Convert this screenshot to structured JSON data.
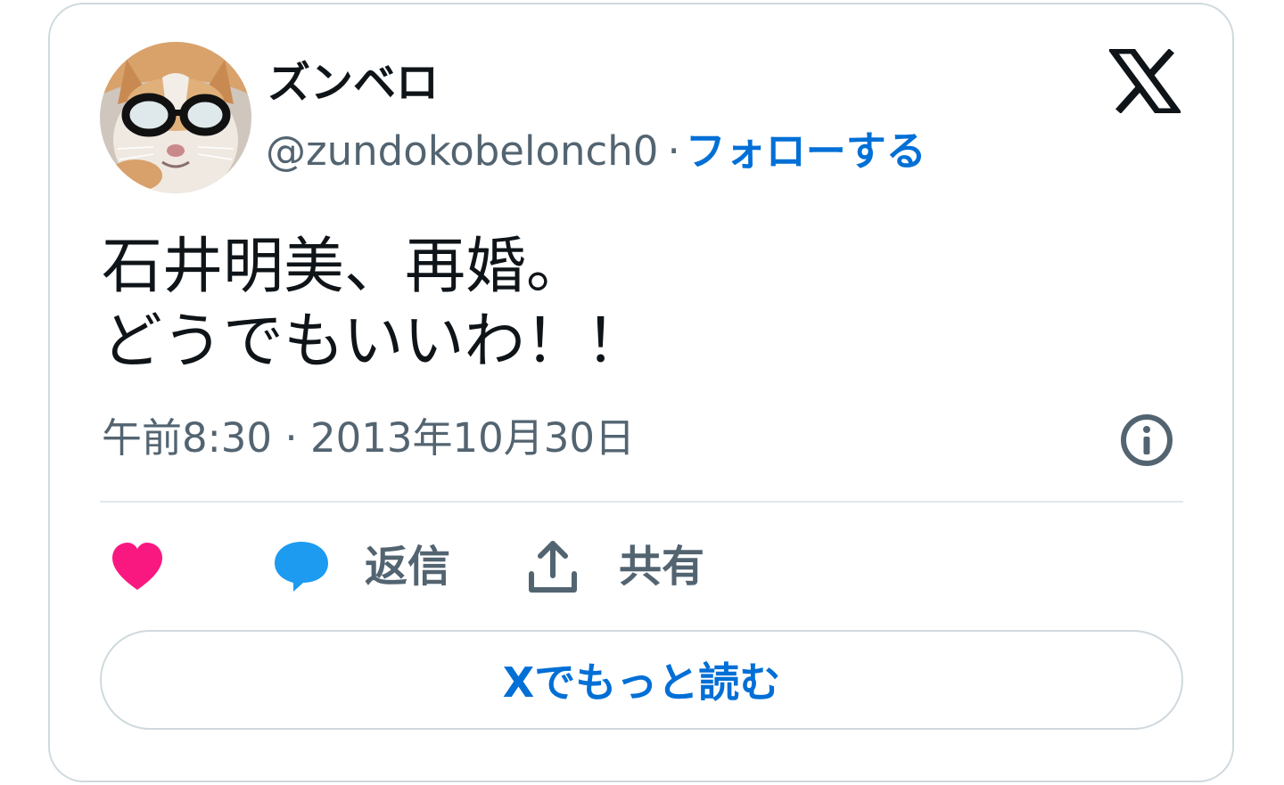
{
  "author": {
    "display_name": "ズンベロ",
    "handle": "@zundokobelonch0",
    "separator": "·",
    "follow_label": "フォローする",
    "avatar_icon": "cat-with-glasses-avatar"
  },
  "brand": {
    "logo_icon": "x-logo-icon"
  },
  "tweet": {
    "lines": [
      "石井明美、再婚。",
      "どうでもいいわ！！"
    ]
  },
  "meta": {
    "timestamp": "午前8:30 · 2013年10月30日",
    "info_icon": "info-icon"
  },
  "actions": {
    "like_icon": "heart-icon",
    "reply_label": "返信",
    "reply_icon": "speech-bubble-icon",
    "share_label": "共有",
    "share_icon": "upload-share-icon"
  },
  "read_more": {
    "label": "Xでもっと読む"
  },
  "colors": {
    "heart": "#f91880",
    "reply_bubble": "#1d9bf0",
    "link": "#006fd6",
    "secondary_text": "#536471",
    "primary_text": "#0f1419",
    "border": "#cfd9de"
  }
}
